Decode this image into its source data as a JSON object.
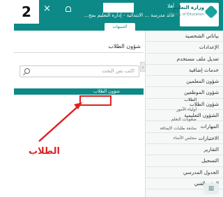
{
  "header": {
    "badge_number": "2",
    "close_symbol": "×",
    "logo_text": "وزارة التعليم",
    "logo_sub": "Ministry of Education",
    "line1": "أهلا",
    "line2": "قائد مدرسة ... الابتدائية - إدارة التعليم بمح...",
    "notifications_tab": "التنبيهات"
  },
  "sidebar": {
    "collapse_symbol": "›",
    "items": [
      {
        "label": "بياناتي الشخصية"
      },
      {
        "label": "الإعدادات"
      },
      {
        "label": "تعديل ملف مستخدم"
      },
      {
        "label": "خدمات إضافية"
      },
      {
        "label": "شؤون المعلمين"
      },
      {
        "label": "شؤون الموظفين"
      },
      {
        "label": "شؤون الطلاب"
      },
      {
        "label": "الشؤون التعليمية"
      },
      {
        "label": "المهارات"
      },
      {
        "label": "الاختبارات"
      },
      {
        "label": "التقارير"
      },
      {
        "label": "التسجيل"
      },
      {
        "label": "الجدول المدرسي"
      },
      {
        "label": "الدعم الفني"
      }
    ]
  },
  "main": {
    "panel_title": "شؤون الطلاب",
    "search": {
      "placeholder": "اكتب نص البحث"
    },
    "group_title": "شؤون الطلاب",
    "sub_items": [
      {
        "label": "الطلاب"
      },
      {
        "label": "أولياء الأمور"
      },
      {
        "label": "صعوبات التعلم"
      },
      {
        "label": "متابعة طلبات الإضافة"
      },
      {
        "label": "مجلس الأمناء"
      }
    ]
  },
  "annotation": {
    "label": "الطلاب",
    "color": "#e02020"
  },
  "colors": {
    "brand": "#0d8a87",
    "sidebar_bg": "#f6f7f7"
  },
  "icons": [
    "close-icon",
    "bell-icon",
    "search-icon",
    "collapse-chevron-icon",
    "logo-icon"
  ]
}
